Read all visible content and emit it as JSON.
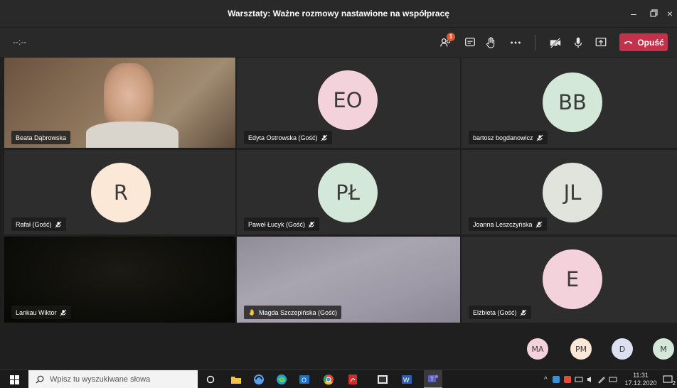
{
  "window": {
    "title": "Warsztaty: Ważne rozmowy nastawione na współpracę"
  },
  "toolbar": {
    "timer": "--:--",
    "participants_badge": "1",
    "leave_label": "Opuść"
  },
  "colors": {
    "leave": "#c4314b",
    "badge": "#d65a36",
    "hand": "#f3c84b"
  },
  "tiles": [
    {
      "name": "Beata Dąbrowska",
      "type": "video"
    },
    {
      "name": "Edyta Ostrowska (Gość)",
      "initials": "EO",
      "avatar_color": "#f4d2dc"
    },
    {
      "name": "bartosz bogdanowicz",
      "initials": "BB",
      "avatar_color": "#d3e8d9"
    },
    {
      "name": "Rafał (Gość)",
      "initials": "R",
      "avatar_color": "#fbe8d6"
    },
    {
      "name": "Paweł Łucyk (Gość)",
      "initials": "PŁ",
      "avatar_color": "#d3e8d9"
    },
    {
      "name": "Joanna Leszczyńska",
      "initials": "JL",
      "avatar_color": "#e0e4dd"
    },
    {
      "name": "Lankau Wiktor",
      "type": "video"
    },
    {
      "name": "Magda Szczepińska (Gość)",
      "type": "video"
    },
    {
      "name": "Elżbieta (Gość)",
      "initials": "E",
      "avatar_color": "#f4d2dc"
    }
  ],
  "overflow": [
    {
      "initials": "MA",
      "color": "#f4d2dc"
    },
    {
      "initials": "PM",
      "color": "#fbe8d6"
    },
    {
      "initials": "D",
      "color": "#dde0f1"
    },
    {
      "initials": "M",
      "color": "#d3e8d9"
    }
  ],
  "taskbar": {
    "search_placeholder": "Wpisz tu wyszukiwane słowa",
    "time": "11:31",
    "date": "17.12.2020",
    "notification_count": "2"
  }
}
